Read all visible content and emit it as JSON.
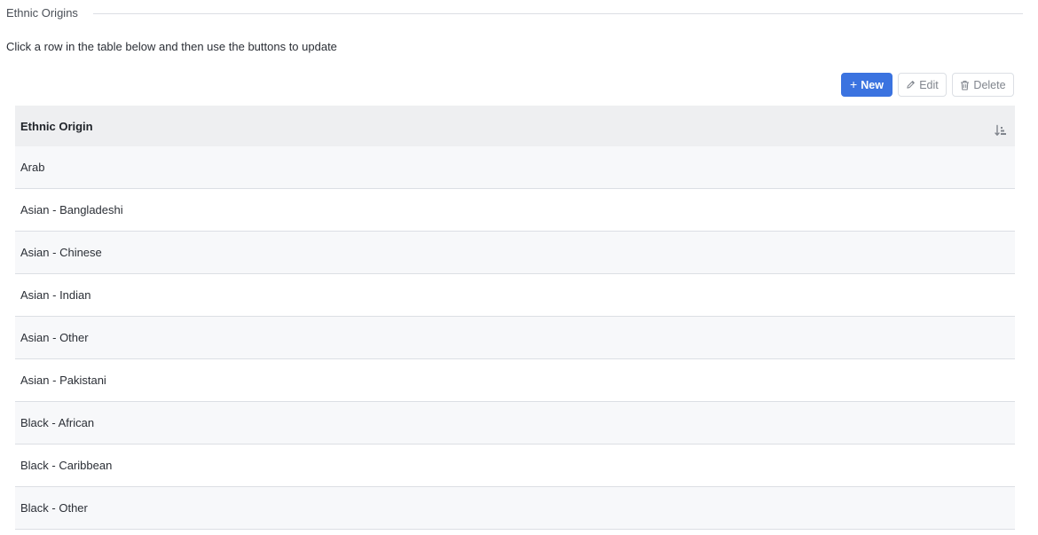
{
  "section": {
    "title": "Ethnic Origins"
  },
  "instructions": "Click a row in the table below and then use the buttons to update",
  "toolbar": {
    "new_label": "New",
    "edit_label": "Edit",
    "delete_label": "Delete",
    "accent_color": "#3b73e0"
  },
  "table": {
    "column_header": "Ethnic Origin",
    "rows": [
      "Arab",
      "Asian - Bangladeshi",
      "Asian - Chinese",
      "Asian - Indian",
      "Asian - Other",
      "Asian - Pakistani",
      "Black - African",
      "Black - Caribbean",
      "Black - Other"
    ]
  }
}
